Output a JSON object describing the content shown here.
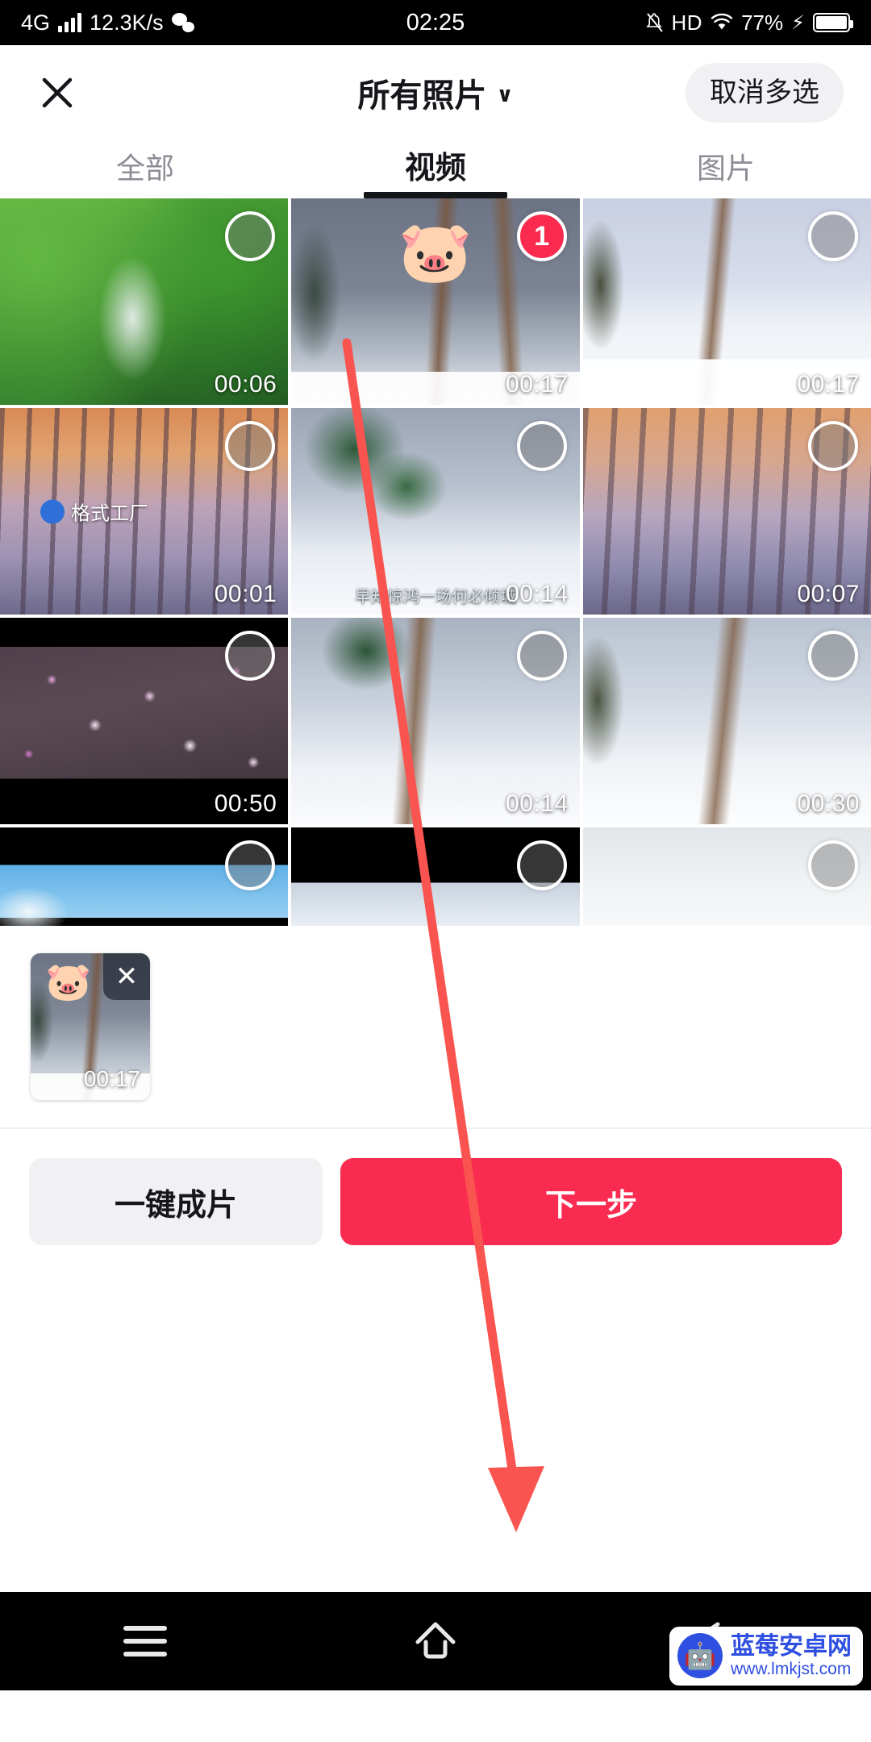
{
  "status_bar": {
    "network_type": "4G",
    "speed": "12.3K/s",
    "time": "02:25",
    "hd_label": "HD",
    "battery_percent": "77%",
    "icons": [
      "signal-bars-icon",
      "wechat-icon",
      "mute-bell-icon",
      "hd-icon",
      "wifi-icon",
      "charging-bolt-icon",
      "battery-icon"
    ]
  },
  "header": {
    "close_label": "✕",
    "album_title": "所有照片",
    "chevron": "∨",
    "cancel_multi_label": "取消多选"
  },
  "tabs": [
    {
      "label": "全部",
      "active": false
    },
    {
      "label": "视频",
      "active": true
    },
    {
      "label": "图片",
      "active": false
    }
  ],
  "grid": {
    "items": [
      {
        "duration": "00:06",
        "selected": false,
        "badge": "",
        "kind": "waterfall"
      },
      {
        "duration": "00:17",
        "selected": true,
        "badge": "1",
        "kind": "snow-bridge-pig"
      },
      {
        "duration": "00:17",
        "selected": false,
        "badge": "",
        "kind": "snow-bridge-light"
      },
      {
        "duration": "00:01",
        "selected": false,
        "badge": "",
        "kind": "sunset-trees",
        "watermark": "格式工厂"
      },
      {
        "duration": "00:14",
        "selected": false,
        "badge": "",
        "kind": "snow-tree-bridge",
        "subtitle": "早知惊鸿一场何必倾城"
      },
      {
        "duration": "00:07",
        "selected": false,
        "badge": "",
        "kind": "sunset-trees2"
      },
      {
        "duration": "00:50",
        "selected": false,
        "badge": "",
        "kind": "plum-blossom"
      },
      {
        "duration": "00:14",
        "selected": false,
        "badge": "",
        "kind": "snow-bridge-tree"
      },
      {
        "duration": "00:30",
        "selected": false,
        "badge": "",
        "kind": "snow-bridge-wide"
      },
      {
        "duration": "",
        "selected": false,
        "badge": "",
        "kind": "birds-sky"
      },
      {
        "duration": "",
        "selected": false,
        "badge": "",
        "kind": "snow-letterbox"
      },
      {
        "duration": "",
        "selected": false,
        "badge": "",
        "kind": "white-sky"
      }
    ]
  },
  "selected_tray": {
    "item": {
      "duration": "00:17",
      "remove_label": "✕",
      "kind": "snow-bridge-pig"
    }
  },
  "bottom_bar": {
    "one_key_label": "一键成片",
    "next_label": "下一步"
  },
  "nav_bar": {
    "items": [
      "menu-icon",
      "home-icon",
      "back-icon"
    ]
  },
  "watermark": {
    "title": "蓝莓安卓网",
    "url": "www.lmkjst.com"
  },
  "colors": {
    "accent_red": "#fa2b50",
    "badge_red": "#fa2b4f",
    "chip_gray": "#f1f1f3",
    "text_dark": "#15161a",
    "text_muted": "#8b8d94",
    "arrow_red": "#f9544f"
  }
}
